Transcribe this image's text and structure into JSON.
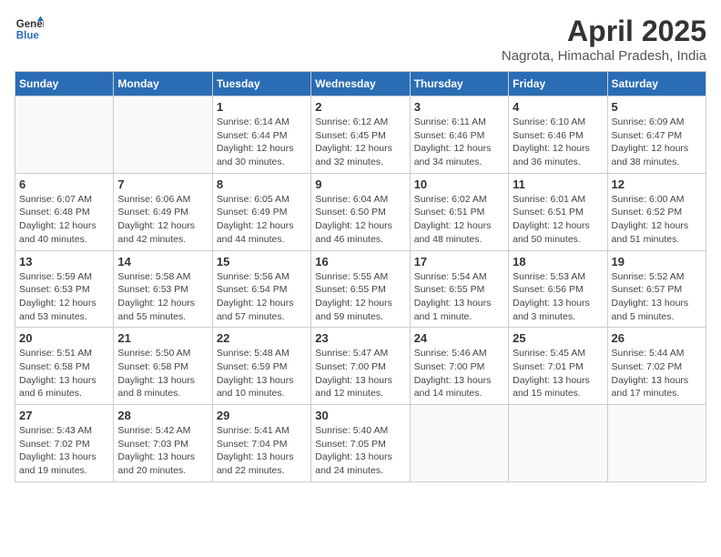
{
  "header": {
    "logo": {
      "line1": "General",
      "line2": "Blue"
    },
    "title": "April 2025",
    "subtitle": "Nagrota, Himachal Pradesh, India"
  },
  "weekdays": [
    "Sunday",
    "Monday",
    "Tuesday",
    "Wednesday",
    "Thursday",
    "Friday",
    "Saturday"
  ],
  "weeks": [
    [
      {
        "day": "",
        "sunrise": "",
        "sunset": "",
        "daylight": ""
      },
      {
        "day": "",
        "sunrise": "",
        "sunset": "",
        "daylight": ""
      },
      {
        "day": "1",
        "sunrise": "Sunrise: 6:14 AM",
        "sunset": "Sunset: 6:44 PM",
        "daylight": "Daylight: 12 hours and 30 minutes."
      },
      {
        "day": "2",
        "sunrise": "Sunrise: 6:12 AM",
        "sunset": "Sunset: 6:45 PM",
        "daylight": "Daylight: 12 hours and 32 minutes."
      },
      {
        "day": "3",
        "sunrise": "Sunrise: 6:11 AM",
        "sunset": "Sunset: 6:46 PM",
        "daylight": "Daylight: 12 hours and 34 minutes."
      },
      {
        "day": "4",
        "sunrise": "Sunrise: 6:10 AM",
        "sunset": "Sunset: 6:46 PM",
        "daylight": "Daylight: 12 hours and 36 minutes."
      },
      {
        "day": "5",
        "sunrise": "Sunrise: 6:09 AM",
        "sunset": "Sunset: 6:47 PM",
        "daylight": "Daylight: 12 hours and 38 minutes."
      }
    ],
    [
      {
        "day": "6",
        "sunrise": "Sunrise: 6:07 AM",
        "sunset": "Sunset: 6:48 PM",
        "daylight": "Daylight: 12 hours and 40 minutes."
      },
      {
        "day": "7",
        "sunrise": "Sunrise: 6:06 AM",
        "sunset": "Sunset: 6:49 PM",
        "daylight": "Daylight: 12 hours and 42 minutes."
      },
      {
        "day": "8",
        "sunrise": "Sunrise: 6:05 AM",
        "sunset": "Sunset: 6:49 PM",
        "daylight": "Daylight: 12 hours and 44 minutes."
      },
      {
        "day": "9",
        "sunrise": "Sunrise: 6:04 AM",
        "sunset": "Sunset: 6:50 PM",
        "daylight": "Daylight: 12 hours and 46 minutes."
      },
      {
        "day": "10",
        "sunrise": "Sunrise: 6:02 AM",
        "sunset": "Sunset: 6:51 PM",
        "daylight": "Daylight: 12 hours and 48 minutes."
      },
      {
        "day": "11",
        "sunrise": "Sunrise: 6:01 AM",
        "sunset": "Sunset: 6:51 PM",
        "daylight": "Daylight: 12 hours and 50 minutes."
      },
      {
        "day": "12",
        "sunrise": "Sunrise: 6:00 AM",
        "sunset": "Sunset: 6:52 PM",
        "daylight": "Daylight: 12 hours and 51 minutes."
      }
    ],
    [
      {
        "day": "13",
        "sunrise": "Sunrise: 5:59 AM",
        "sunset": "Sunset: 6:53 PM",
        "daylight": "Daylight: 12 hours and 53 minutes."
      },
      {
        "day": "14",
        "sunrise": "Sunrise: 5:58 AM",
        "sunset": "Sunset: 6:53 PM",
        "daylight": "Daylight: 12 hours and 55 minutes."
      },
      {
        "day": "15",
        "sunrise": "Sunrise: 5:56 AM",
        "sunset": "Sunset: 6:54 PM",
        "daylight": "Daylight: 12 hours and 57 minutes."
      },
      {
        "day": "16",
        "sunrise": "Sunrise: 5:55 AM",
        "sunset": "Sunset: 6:55 PM",
        "daylight": "Daylight: 12 hours and 59 minutes."
      },
      {
        "day": "17",
        "sunrise": "Sunrise: 5:54 AM",
        "sunset": "Sunset: 6:55 PM",
        "daylight": "Daylight: 13 hours and 1 minute."
      },
      {
        "day": "18",
        "sunrise": "Sunrise: 5:53 AM",
        "sunset": "Sunset: 6:56 PM",
        "daylight": "Daylight: 13 hours and 3 minutes."
      },
      {
        "day": "19",
        "sunrise": "Sunrise: 5:52 AM",
        "sunset": "Sunset: 6:57 PM",
        "daylight": "Daylight: 13 hours and 5 minutes."
      }
    ],
    [
      {
        "day": "20",
        "sunrise": "Sunrise: 5:51 AM",
        "sunset": "Sunset: 6:58 PM",
        "daylight": "Daylight: 13 hours and 6 minutes."
      },
      {
        "day": "21",
        "sunrise": "Sunrise: 5:50 AM",
        "sunset": "Sunset: 6:58 PM",
        "daylight": "Daylight: 13 hours and 8 minutes."
      },
      {
        "day": "22",
        "sunrise": "Sunrise: 5:48 AM",
        "sunset": "Sunset: 6:59 PM",
        "daylight": "Daylight: 13 hours and 10 minutes."
      },
      {
        "day": "23",
        "sunrise": "Sunrise: 5:47 AM",
        "sunset": "Sunset: 7:00 PM",
        "daylight": "Daylight: 13 hours and 12 minutes."
      },
      {
        "day": "24",
        "sunrise": "Sunrise: 5:46 AM",
        "sunset": "Sunset: 7:00 PM",
        "daylight": "Daylight: 13 hours and 14 minutes."
      },
      {
        "day": "25",
        "sunrise": "Sunrise: 5:45 AM",
        "sunset": "Sunset: 7:01 PM",
        "daylight": "Daylight: 13 hours and 15 minutes."
      },
      {
        "day": "26",
        "sunrise": "Sunrise: 5:44 AM",
        "sunset": "Sunset: 7:02 PM",
        "daylight": "Daylight: 13 hours and 17 minutes."
      }
    ],
    [
      {
        "day": "27",
        "sunrise": "Sunrise: 5:43 AM",
        "sunset": "Sunset: 7:02 PM",
        "daylight": "Daylight: 13 hours and 19 minutes."
      },
      {
        "day": "28",
        "sunrise": "Sunrise: 5:42 AM",
        "sunset": "Sunset: 7:03 PM",
        "daylight": "Daylight: 13 hours and 20 minutes."
      },
      {
        "day": "29",
        "sunrise": "Sunrise: 5:41 AM",
        "sunset": "Sunset: 7:04 PM",
        "daylight": "Daylight: 13 hours and 22 minutes."
      },
      {
        "day": "30",
        "sunrise": "Sunrise: 5:40 AM",
        "sunset": "Sunset: 7:05 PM",
        "daylight": "Daylight: 13 hours and 24 minutes."
      },
      {
        "day": "",
        "sunrise": "",
        "sunset": "",
        "daylight": ""
      },
      {
        "day": "",
        "sunrise": "",
        "sunset": "",
        "daylight": ""
      },
      {
        "day": "",
        "sunrise": "",
        "sunset": "",
        "daylight": ""
      }
    ]
  ]
}
